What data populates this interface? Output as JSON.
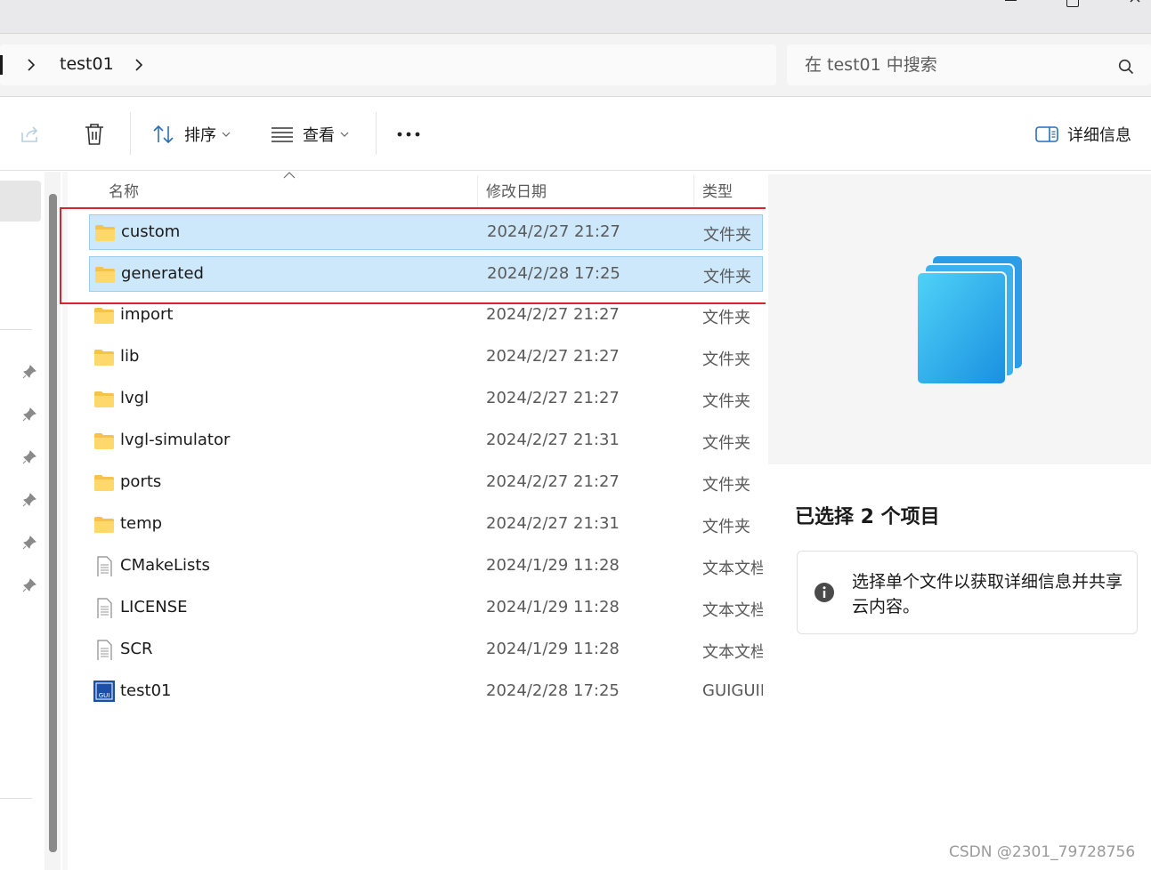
{
  "window": {
    "controls": [
      "minimize-icon",
      "maximize-icon",
      "close-icon"
    ]
  },
  "address_bar": {
    "segments": [
      "test01"
    ],
    "search_placeholder": "在 test01 中搜索"
  },
  "toolbar": {
    "sort_label": "排序",
    "view_label": "查看",
    "more_label": "···",
    "details_label": "详细信息"
  },
  "file_list": {
    "columns": {
      "name": "名称",
      "date": "修改日期",
      "type": "类型"
    },
    "rows": [
      {
        "name": "custom",
        "date": "2024/2/27 21:27",
        "type": "文件夹",
        "icon": "folder-icon",
        "selected": true
      },
      {
        "name": "generated",
        "date": "2024/2/28 17:25",
        "type": "文件夹",
        "icon": "folder-icon",
        "selected": true
      },
      {
        "name": "import",
        "date": "2024/2/27 21:27",
        "type": "文件夹",
        "icon": "folder-icon",
        "selected": false
      },
      {
        "name": "lib",
        "date": "2024/2/27 21:27",
        "type": "文件夹",
        "icon": "folder-icon",
        "selected": false
      },
      {
        "name": "lvgl",
        "date": "2024/2/27 21:27",
        "type": "文件夹",
        "icon": "folder-icon",
        "selected": false
      },
      {
        "name": "lvgl-simulator",
        "date": "2024/2/27 21:31",
        "type": "文件夹",
        "icon": "folder-icon",
        "selected": false
      },
      {
        "name": "ports",
        "date": "2024/2/27 21:27",
        "type": "文件夹",
        "icon": "folder-icon",
        "selected": false
      },
      {
        "name": "temp",
        "date": "2024/2/27 21:31",
        "type": "文件夹",
        "icon": "folder-icon",
        "selected": false
      },
      {
        "name": "CMakeLists",
        "date": "2024/1/29 11:28",
        "type": "文本文档",
        "icon": "text-file-icon",
        "selected": false
      },
      {
        "name": "LICENSE",
        "date": "2024/1/29 11:28",
        "type": "文本文档",
        "icon": "text-file-icon",
        "selected": false
      },
      {
        "name": "SCR",
        "date": "2024/1/29 11:28",
        "type": "文本文档",
        "icon": "text-file-icon",
        "selected": false
      },
      {
        "name": "test01",
        "date": "2024/2/28 17:25",
        "type": "GUIGUIDER",
        "icon": "gui-guider-file-icon",
        "selected": false
      }
    ]
  },
  "details_pane": {
    "title": "已选择 2 个项目",
    "info_text": "选择单个文件以获取详细信息并共享云内容。"
  },
  "colors": {
    "selection_fill": "#cde8fb",
    "selection_border": "#99cdf1",
    "annotation_red": "#d9232e",
    "preview_blue": "#29a8ea"
  },
  "watermark": "CSDN @2301_79728756"
}
